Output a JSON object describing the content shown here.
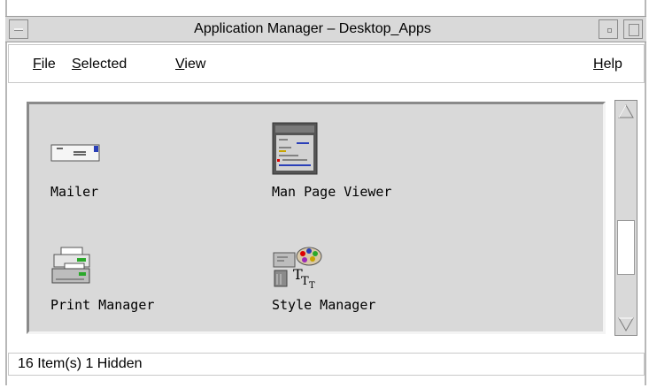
{
  "window": {
    "title": "Application Manager – Desktop_Apps"
  },
  "menubar": {
    "items": [
      {
        "label_ul": "F",
        "label_rest": "ile"
      },
      {
        "label_ul": "S",
        "label_rest": "elected"
      },
      {
        "label_ul": "V",
        "label_rest": "iew"
      }
    ],
    "help": {
      "label_ul": "H",
      "label_rest": "elp"
    }
  },
  "icons": [
    {
      "label": "Mailer",
      "icon": "mailer-icon"
    },
    {
      "label": "Man Page Viewer",
      "icon": "man-page-viewer-icon"
    },
    {
      "label": "Print Manager",
      "icon": "print-manager-icon"
    },
    {
      "label": "Style Manager",
      "icon": "style-manager-icon"
    }
  ],
  "status": {
    "text": "16 Item(s) 1 Hidden"
  },
  "colors": {
    "background": "#d9d9d9",
    "window": "#ffffff"
  }
}
